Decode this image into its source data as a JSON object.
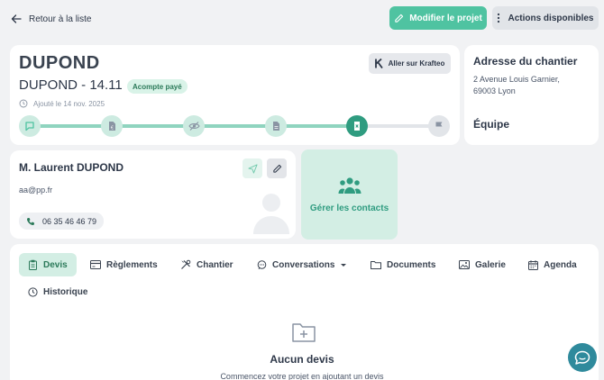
{
  "topbar": {
    "back_label": "Retour à la liste",
    "edit_label": "Modifier le projet",
    "actions_label": "Actions disponibles"
  },
  "project": {
    "client_name": "DUPOND",
    "reference": "DUPOND - 14.11",
    "status_badge": "Acompte payé",
    "added_date": "Ajouté le 14 nov. 2025",
    "krafteo_button": "Aller sur Krafteo",
    "steps": [
      {
        "icon": "chat-icon",
        "state": "done"
      },
      {
        "icon": "document-euro-icon",
        "state": "done"
      },
      {
        "icon": "eye-off-icon",
        "state": "done"
      },
      {
        "icon": "file-icon",
        "state": "done"
      },
      {
        "icon": "invoice-icon",
        "state": "current"
      },
      {
        "icon": "flag-icon",
        "state": "todo"
      }
    ]
  },
  "site": {
    "address_title": "Adresse du chantier",
    "address_line1": "2 Avenue Louis Garnier,",
    "address_line2": "69003 Lyon",
    "team_title": "Équipe"
  },
  "contact": {
    "name": "M. Laurent DUPOND",
    "email": "aa@pp.fr",
    "phone": "06 35 46 46 79",
    "manage_label": "Gérer les contacts"
  },
  "tabs": [
    {
      "label": "Devis",
      "active": true
    },
    {
      "label": "Règlements"
    },
    {
      "label": "Chantier"
    },
    {
      "label": "Conversations"
    },
    {
      "label": "Documents"
    },
    {
      "label": "Galerie"
    },
    {
      "label": "Agenda"
    },
    {
      "label": "Historique"
    }
  ],
  "empty_state": {
    "title": "Aucun devis",
    "subtitle": "Commencez votre projet en ajoutant un devis"
  },
  "colors": {
    "accent": "#4fc3a1",
    "accent_dark": "#2f9c80",
    "accent_light": "#d3eee4",
    "chat": "#2f8a9c"
  }
}
